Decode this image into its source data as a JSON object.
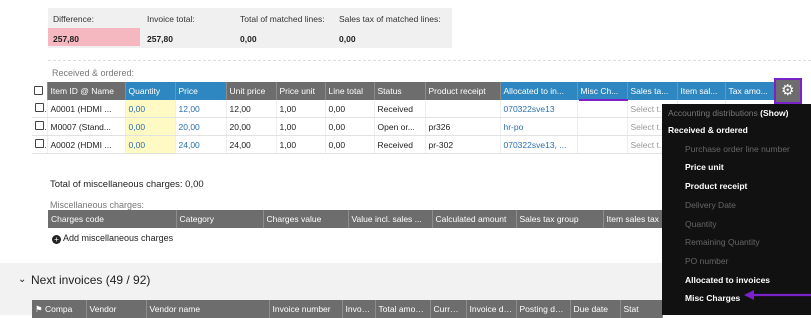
{
  "summary": {
    "difference_label": "Difference:",
    "difference_value": "257,80",
    "invoice_total_label": "Invoice total:",
    "invoice_total_value": "257,80",
    "matched_label": "Total of matched lines:",
    "matched_value": "0,00",
    "sales_tax_label": "Sales tax of matched lines:",
    "sales_tax_value": "0,00"
  },
  "received": {
    "title": "Received & ordered:",
    "columns": [
      "Item ID @ Name",
      "Quantity",
      "Price",
      "Unit price",
      "Price unit",
      "Line total",
      "Status",
      "Product receipt",
      "Allocated to in...",
      "Misc Ch...",
      "Sales ta...",
      "Item sal...",
      "Tax amo..."
    ],
    "rows": [
      {
        "item": "A0001 (HDMI ...",
        "quantity": "0,00",
        "price": "12,00",
        "unit_price": "12,00",
        "price_unit": "1,00",
        "line_total": "0,00",
        "status": "Received",
        "receipt": "",
        "allocated": "070322sve13",
        "select": "Select t..."
      },
      {
        "item": "M0007 (Stand...",
        "quantity": "0,00",
        "price": "20,00",
        "unit_price": "20,00",
        "price_unit": "1,00",
        "line_total": "0,00",
        "status": "Open or...",
        "receipt": "pr326",
        "allocated": "hr-po",
        "select": "Select t..."
      },
      {
        "item": "A0002 (HDMI ...",
        "quantity": "0,00",
        "price": "24,00",
        "unit_price": "24,00",
        "price_unit": "1,00",
        "line_total": "0,00",
        "status": "Received",
        "receipt": "pr-302",
        "allocated": "070322sve13, ...",
        "select": "Select t..."
      }
    ]
  },
  "misc": {
    "total_label": "Total of miscellaneous charges: 0,00",
    "title": "Miscellaneous charges:",
    "columns": [
      "Charges code",
      "Category",
      "Charges value",
      "Value incl. sales ...",
      "Calculated amount",
      "Sales tax group",
      "Item sales tax"
    ],
    "add_label": "Add miscellaneous charges"
  },
  "next_invoices": {
    "title": "Next invoices (49 / 92)",
    "columns": [
      "Compa",
      "Vendor",
      "Vendor name",
      "Invoice number",
      "Invoice",
      "Total amount",
      "Currenc",
      "Invoice date",
      "Posting date",
      "Due date",
      "Stat"
    ]
  },
  "column_menu": {
    "items": [
      {
        "label": "Accounting distributions",
        "suffix": "(Show)",
        "style": "dim-header"
      },
      {
        "label": "Received & ordered",
        "style": "section"
      },
      {
        "label": "Purchase order line number",
        "style": "dim"
      },
      {
        "label": "Price unit",
        "style": "bold"
      },
      {
        "label": "Product receipt",
        "style": "bold"
      },
      {
        "label": "Delivery Date",
        "style": "dim"
      },
      {
        "label": "Quantity",
        "style": "dim"
      },
      {
        "label": "Remaining Quantity",
        "style": "dim"
      },
      {
        "label": "PO number",
        "style": "dim"
      },
      {
        "label": "Allocated to invoices",
        "style": "bold"
      },
      {
        "label": "Misc Charges",
        "style": "bold"
      }
    ]
  },
  "colors": {
    "accent_purple": "#7a22c8",
    "header_blue": "#2e87c0",
    "difference_bg": "#f5b8c0"
  }
}
